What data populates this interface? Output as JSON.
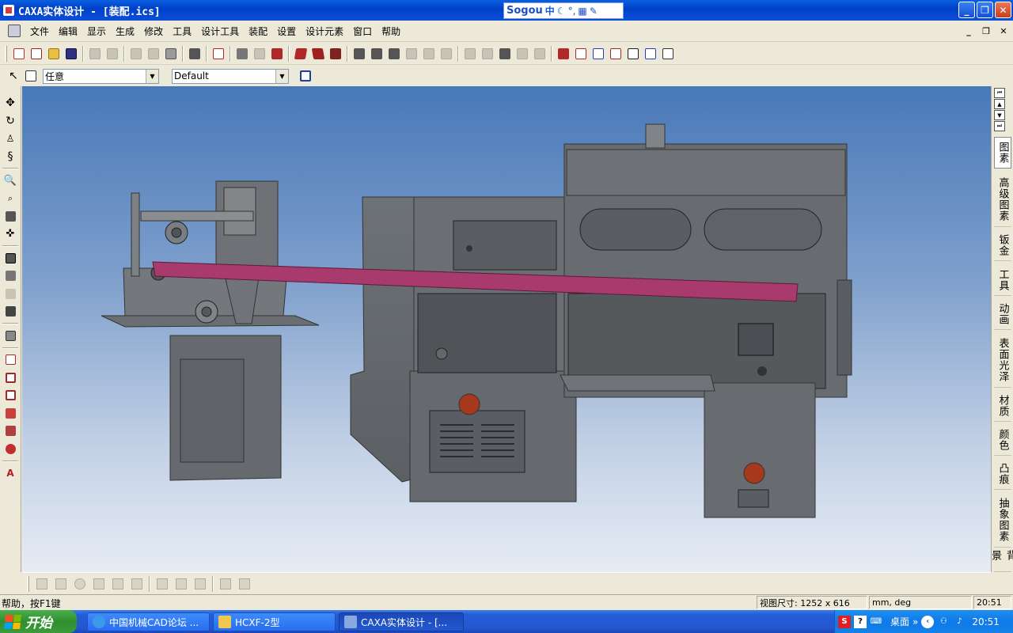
{
  "window": {
    "title": "CAXA实体设计 - [装配.ics]",
    "ime_logo": "Sogou",
    "ime_mode": "中"
  },
  "menu": [
    "文件",
    "编辑",
    "显示",
    "生成",
    "修改",
    "工具",
    "设计工具",
    "装配",
    "设置",
    "设计元素",
    "窗口",
    "帮助"
  ],
  "toolbar2": {
    "filter_value": "任意",
    "style_value": "Default"
  },
  "right_tabs": [
    "图素",
    "高级图素",
    "钣金",
    "工具",
    "动画",
    "表面光泽",
    "材质",
    "颜色",
    "凸痕",
    "抽象图素",
    "背景"
  ],
  "status": {
    "help": "帮助，按F1键",
    "view_size": "视图尺寸: 1252 x  616",
    "units": "mm, deg",
    "time": "20:51"
  },
  "taskbar": {
    "start_label": "开始",
    "tasks": [
      {
        "label": "中国机械CAD论坛 ..."
      },
      {
        "label": "HCXF-2型"
      },
      {
        "label": "CAXA实体设计 - [..."
      }
    ],
    "tray_label": "桌面",
    "clock": "20:51"
  },
  "colors": {
    "accent_conveyor": "#a83a6e",
    "machine_gray": "#6b7074",
    "indicator_red": "#a8381c"
  }
}
